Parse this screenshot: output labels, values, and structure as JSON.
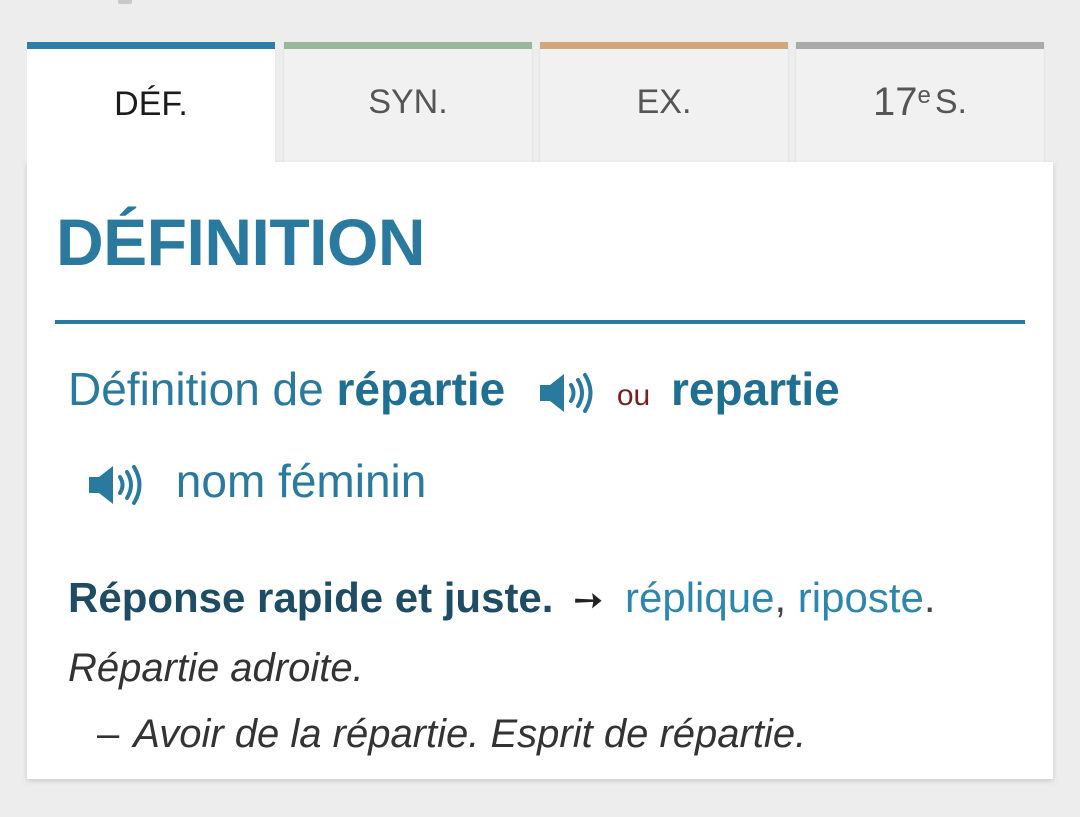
{
  "tabs": [
    {
      "label": "DÉF.",
      "color": "#2b7fa8",
      "active": true
    },
    {
      "label": "SYN.",
      "color": "#98b89a",
      "active": false
    },
    {
      "label": "EX.",
      "color": "#d2a87b",
      "active": false
    },
    {
      "label_main": "17",
      "label_sup": "e",
      "label_tail": "S.",
      "color": "#aaaaaa",
      "active": false
    }
  ],
  "section": {
    "title": "DÉFINITION"
  },
  "entry": {
    "prefix": "Définition de",
    "word1": "répartie",
    "connector": "ou",
    "word2": "repartie",
    "category": "nom féminin"
  },
  "definition": {
    "text": "Réponse rapide et juste.",
    "arrow": "➙",
    "synonyms": [
      "réplique",
      "riposte"
    ],
    "separator": ",",
    "end": "."
  },
  "examples": {
    "first": "Répartie adroite.",
    "dash": "–",
    "second": "Avoir de la répartie. Esprit de répartie."
  },
  "icons": {
    "audio": "speaker-icon"
  },
  "colors": {
    "accent": "#2a7aa0",
    "connector": "#7a1f1f",
    "link": "#2e86ad"
  }
}
